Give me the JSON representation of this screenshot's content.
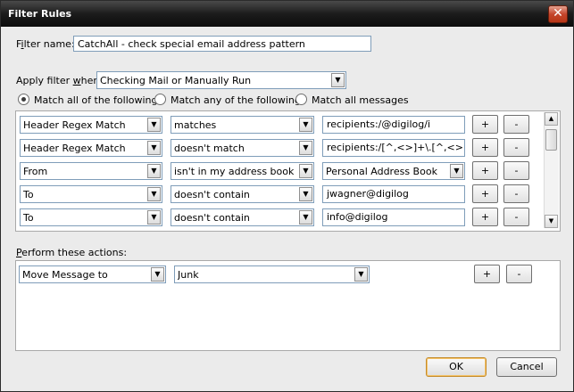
{
  "window": {
    "title": "Filter Rules",
    "close_glyph": "✕"
  },
  "filter_name": {
    "label_pre": "F",
    "label_u": "i",
    "label_post": "lter name:",
    "value": "CatchAll - check special email address pattern"
  },
  "apply_when": {
    "label_pre": "Apply filter ",
    "label_u": "w",
    "label_post": "hen:",
    "value": "Checking Mail or Manually Run"
  },
  "match": {
    "all_label": "Match all of the following",
    "any_label": "Match any of the following",
    "all_messages_label": "Match all messages",
    "selected": "all"
  },
  "rules": [
    {
      "field": "Header Regex Match",
      "operator": "matches",
      "value": "recipients:/@digilog/i",
      "value_is_combo": false
    },
    {
      "field": "Header Regex Match",
      "operator": "doesn't match",
      "value": "recipients:/[^,<>]+\\.[^,<>]+@dig",
      "value_is_combo": false
    },
    {
      "field": "From",
      "operator": "isn't in my address book",
      "value": "Personal Address Book",
      "value_is_combo": true
    },
    {
      "field": "To",
      "operator": "doesn't contain",
      "value": "jwagner@digilog",
      "value_is_combo": false
    },
    {
      "field": "To",
      "operator": "doesn't contain",
      "value": "info@digilog",
      "value_is_combo": false
    }
  ],
  "row_buttons": {
    "add": "+",
    "remove": "-"
  },
  "actions_label": {
    "label_u": "P",
    "label_post": "erform these actions:"
  },
  "actions": [
    {
      "action": "Move Message to",
      "target": "Junk"
    }
  ],
  "buttons": {
    "ok": "OK",
    "cancel": "Cancel"
  },
  "icons": {
    "dropdown": "chevron-down-icon",
    "scroll_up": "arrow-up-icon",
    "scroll_down": "arrow-down-icon"
  }
}
